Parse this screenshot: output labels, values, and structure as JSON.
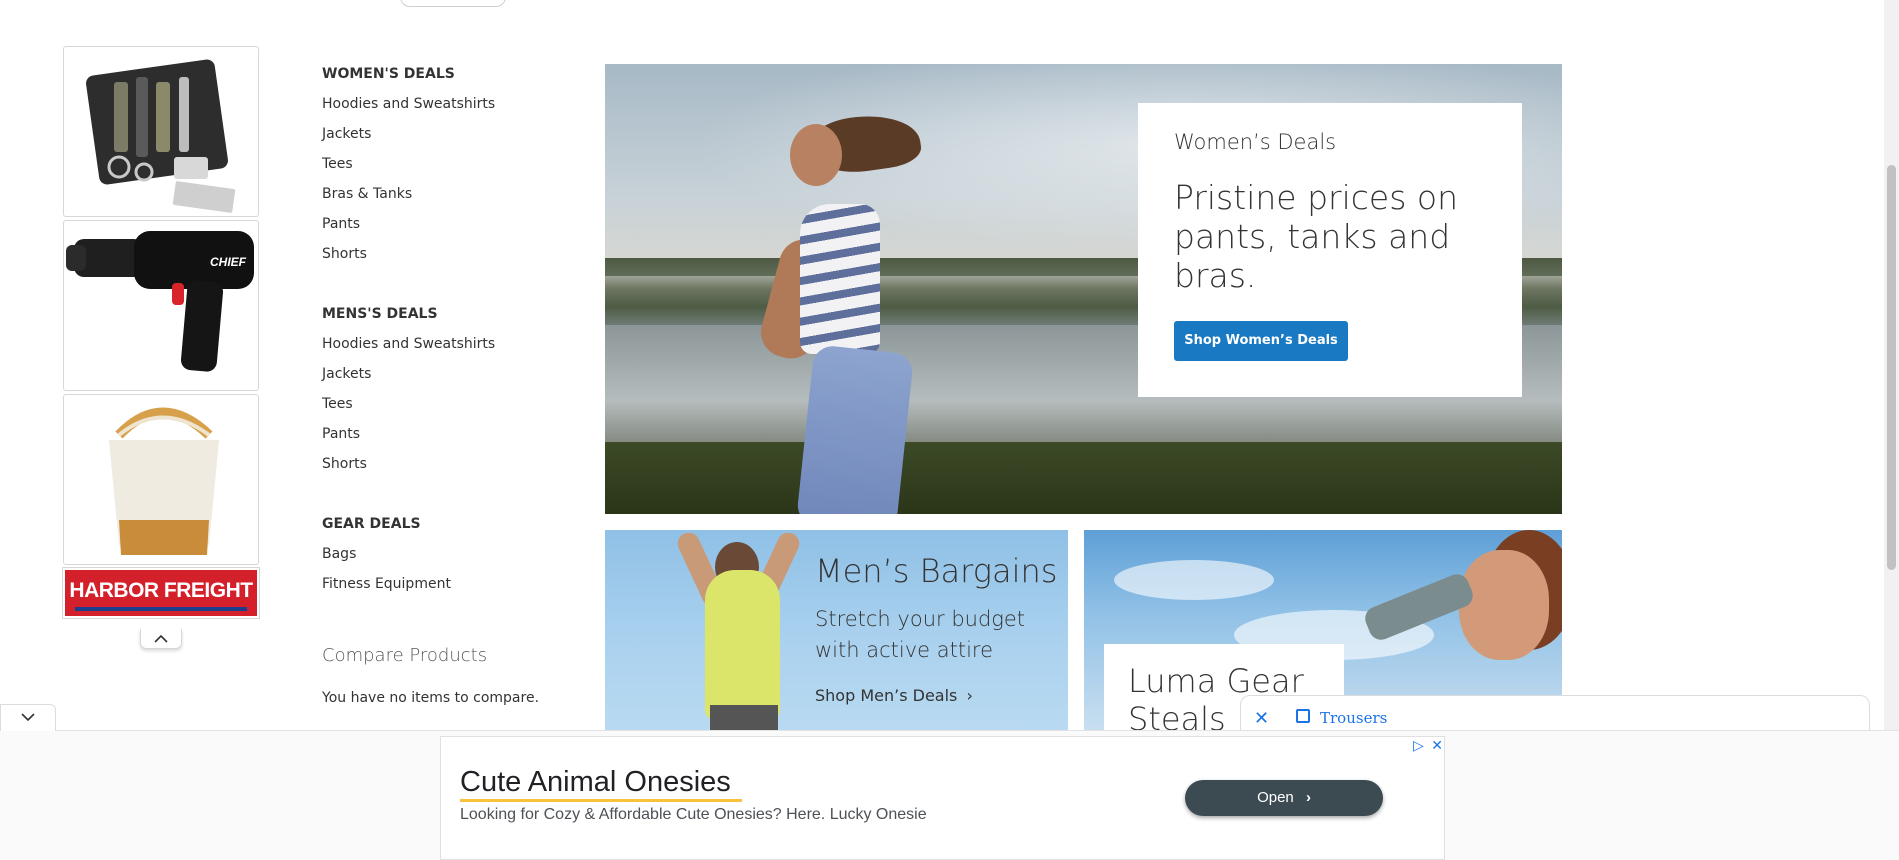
{
  "nav": {
    "women": {
      "heading": "WOMEN'S DEALS",
      "links": [
        "Hoodies and Sweatshirts",
        "Jackets",
        "Tees",
        "Bras & Tanks",
        "Pants",
        "Shorts"
      ]
    },
    "men": {
      "heading": "MENS'S DEALS",
      "links": [
        "Hoodies and Sweatshirts",
        "Jackets",
        "Tees",
        "Pants",
        "Shorts"
      ]
    },
    "gear": {
      "heading": "GEAR DEALS",
      "links": [
        "Bags",
        "Fitness Equipment"
      ]
    }
  },
  "compare": {
    "title": "Compare Products",
    "empty_text": "You have no items to compare."
  },
  "hero": {
    "kicker": "Women’s Deals",
    "headline": "Pristine prices on pants, tanks and bras.",
    "button": "Shop Women’s Deals"
  },
  "men_tile": {
    "title": "Men’s Bargains",
    "subtitle": "Stretch your budget with active attire",
    "link": "Shop Men’s Deals"
  },
  "gear_tile": {
    "title": "Luma Gear Steals"
  },
  "side_ad": {
    "brand": "HARBOR FREIGHT",
    "product_2_text": "CHIEF"
  },
  "floating_bar": {
    "label": "Trousers"
  },
  "bottom_ad": {
    "title": "Cute Animal Onesies",
    "description": "Looking for Cozy & Affordable Cute Onesies? Here. Lucky Onesie",
    "button": "Open"
  },
  "colors": {
    "primary_button": "#1979c3",
    "ad_link_blue": "#1a73e8",
    "harbor_red": "#d4202a"
  }
}
